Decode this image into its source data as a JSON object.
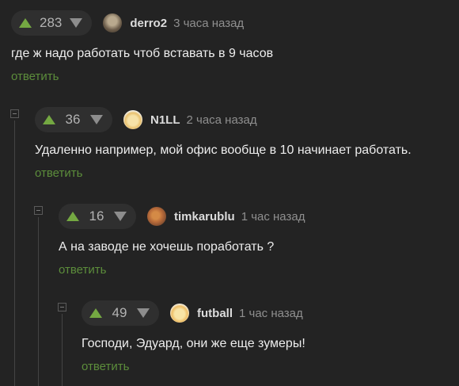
{
  "comments": [
    {
      "rating": "283",
      "username": "derro2",
      "time": "3 часа назад",
      "text": "где ж надо работать чтоб вставать в 9 часов",
      "reply": "ответить",
      "avatar_icon": "photo-avatar"
    },
    {
      "rating": "36",
      "username": "N1LL",
      "time": "2 часа назад",
      "text": "Удаленно например, мой офис вообще в 10 начинает работать.",
      "reply": "ответить",
      "avatar_icon": "beer-avatar"
    },
    {
      "rating": "16",
      "username": "timkarublu",
      "time": "1 час назад",
      "text": "А на заводе не хочешь поработать ?",
      "reply": "ответить",
      "avatar_icon": "pizza-avatar"
    },
    {
      "rating": "49",
      "username": "futball",
      "time": "1 час назад",
      "text": "Господи, Эдуард, они же еще зумеры!",
      "reply": "ответить",
      "avatar_icon": "beer-avatar"
    }
  ],
  "colors": {
    "background": "#232323",
    "upvote": "#74a842",
    "reply_link": "#5c8d3b",
    "thread_line": "#444444"
  }
}
